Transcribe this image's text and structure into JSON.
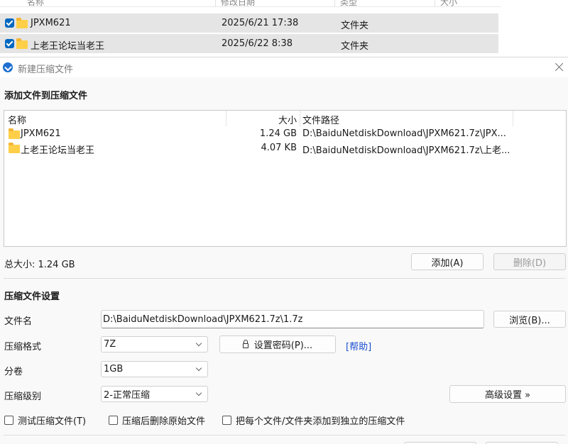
{
  "explorer": {
    "header": {
      "name": "名称",
      "date": "修改日期",
      "type": "类型",
      "size": "大小"
    },
    "rows": [
      {
        "name": "JPXM621",
        "date": "2025/6/21 17:38",
        "type": "文件夹"
      },
      {
        "name": "上老王论坛当老王",
        "date": "2025/6/22 8:38",
        "type": "文件夹"
      }
    ]
  },
  "dialog": {
    "title": "新建压缩文件",
    "add_section_title": "添加文件到压缩文件",
    "list_headers": {
      "name": "名称",
      "size": "大小",
      "path": "文件路径"
    },
    "files": [
      {
        "name": "JPXM621",
        "size": "1.24 GB",
        "path": "D:\\BaiduNetdiskDownload\\JPXM621.7z\\JPX..."
      },
      {
        "name": "上老王论坛当老王",
        "size": "4.07 KB",
        "path": "D:\\BaiduNetdiskDownload\\JPXM621.7z\\上老..."
      }
    ],
    "total_size": "总大小: 1.24 GB",
    "add_button": "添加(A)",
    "delete_button": "删除(D)",
    "settings_title": "压缩文件设置",
    "filename_label": "文件名",
    "filename_value": "D:\\BaiduNetdiskDownload\\JPXM621.7z\\1.7z",
    "browse_button": "浏览(B)...",
    "format_label": "压缩格式",
    "format_value": "7Z",
    "password_button": "设置密码(P)...",
    "help_link": "[帮助]",
    "volume_label": "分卷",
    "volume_value": "1GB",
    "level_label": "压缩级别",
    "level_value": "2-正常压缩",
    "advanced_button": "高级设置 »",
    "options": {
      "test": "测试压缩文件(T)",
      "delete_after": "压缩后删除原始文件",
      "separate": "把每个文件/文件夹添加到独立的压缩文件"
    }
  }
}
